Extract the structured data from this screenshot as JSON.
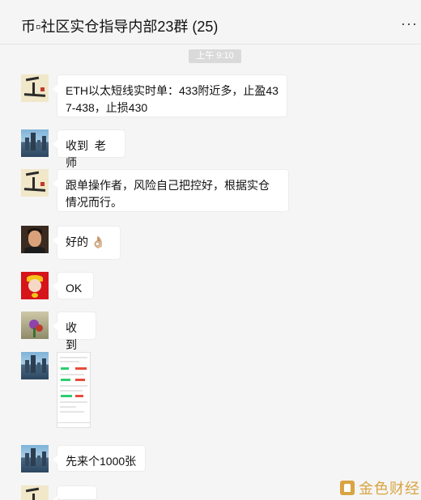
{
  "window": {
    "controls": [
      "⚲",
      "—",
      "☐",
      "✕"
    ]
  },
  "header": {
    "title": "币▫社区实仓指导内部23群 (25)",
    "more": "···"
  },
  "timestamp": "上午 9:10",
  "messages": [
    {
      "avatar": "calligraphy-avatar",
      "text": "ETH以太短线实时单：433附近多，止盈437-438，止损430"
    },
    {
      "avatar": "city-avatar",
      "text": "收到  老师"
    },
    {
      "avatar": "calligraphy-avatar",
      "text": "跟单操作者，风险自己把控好，根据实仓情况而行。"
    },
    {
      "avatar": "portrait-avatar",
      "text": "好的 👌🏼"
    },
    {
      "avatar": "fortune-avatar",
      "text": "OK"
    },
    {
      "avatar": "flower-avatar",
      "text": "收到"
    },
    {
      "avatar": "city-avatar",
      "image": "trading-app-screenshot"
    },
    {
      "avatar": "city-avatar",
      "text": "先来个1000张"
    },
    {
      "avatar": "calligraphy-avatar",
      "text": ""
    }
  ],
  "watermark": {
    "text": "金色财经"
  },
  "colors": {
    "background": "#f5f5f5",
    "bubble": "#ffffff",
    "timestamp_bg": "#dadada",
    "watermark": "#d9a441"
  }
}
